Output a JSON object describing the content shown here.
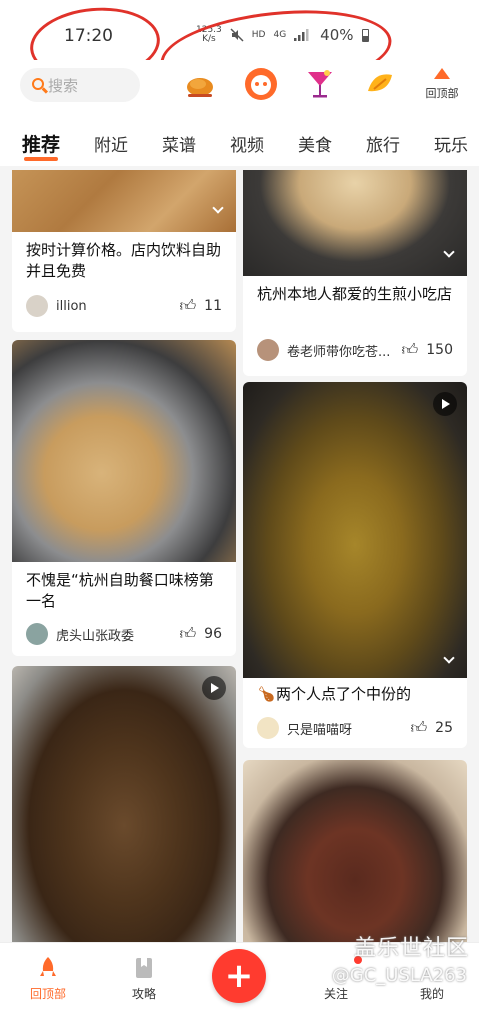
{
  "status": {
    "time": "17:20",
    "net_speed_value": "125.3",
    "net_speed_unit": "K/s",
    "hd": "HD",
    "network": "4G",
    "battery": "40%"
  },
  "header": {
    "search_placeholder": "搜索",
    "top_button_label": "回顶部",
    "icons": [
      "roast-chicken-icon",
      "cat-face-icon",
      "cocktail-icon",
      "mango-icon"
    ]
  },
  "tabs": [
    {
      "label": "推荐",
      "active": true
    },
    {
      "label": "附近"
    },
    {
      "label": "菜谱"
    },
    {
      "label": "视频"
    },
    {
      "label": "美食"
    },
    {
      "label": "旅行"
    },
    {
      "label": "玩乐"
    }
  ],
  "cards": [
    {
      "title": "按时计算价格。店内饮料自助并且免费",
      "author": "illion",
      "likes": "11"
    },
    {
      "title": "杭州本地人都爱的生煎小吃店",
      "author": "卷老师带你吃苍...",
      "likes": "150"
    },
    {
      "title": "不愧是“杭州自助餐口味榜第一名",
      "author": "虎头山张政委",
      "likes": "96"
    },
    {
      "title": "两个人点了个中份的",
      "author": "只是喵喵呀",
      "likes": "25"
    },
    {
      "title": "",
      "author": "",
      "likes": ""
    },
    {
      "title": "",
      "author": "",
      "likes": ""
    }
  ],
  "bottom_nav": {
    "home": "回顶部",
    "guide": "攻略",
    "follow": "关注",
    "mine": "我的"
  },
  "watermark": {
    "line1": "盖乐世社区",
    "line2": "@GC_USLA263"
  },
  "colors": {
    "accent": "#ff6a2a",
    "plus_button": "#ff3b2f",
    "annotation_circle": "#e0322a"
  }
}
